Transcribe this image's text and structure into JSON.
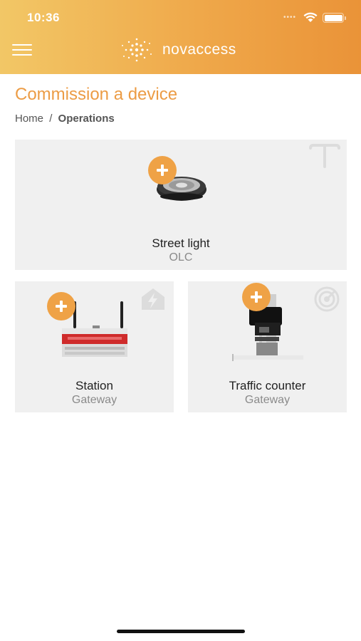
{
  "status_bar": {
    "time": "10:36"
  },
  "header": {
    "brand_name": "novaccess"
  },
  "page": {
    "title": "Commission a device",
    "breadcrumb": {
      "home": "Home",
      "separator": "/",
      "current": "Operations"
    }
  },
  "devices": [
    {
      "name": "Street light",
      "type": "OLC",
      "icon": "pole-icon"
    },
    {
      "name": "Station",
      "type": "Gateway",
      "icon": "lightning-house-icon"
    },
    {
      "name": "Traffic counter",
      "type": "Gateway",
      "icon": "radar-icon"
    }
  ],
  "colors": {
    "accent": "#efa246",
    "header_start": "#f2c766",
    "header_end": "#ea9338",
    "card_bg": "#f0f0f0"
  }
}
